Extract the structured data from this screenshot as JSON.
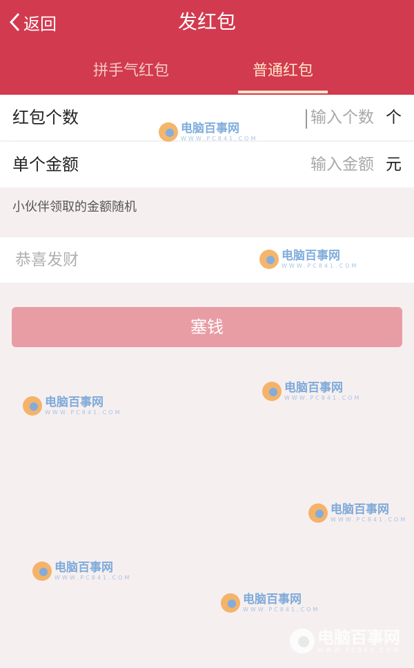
{
  "header": {
    "back_label": "返回",
    "title": "发红包",
    "tabs": [
      {
        "label": "拼手气红包"
      },
      {
        "label": "普通红包"
      }
    ]
  },
  "form": {
    "count": {
      "label": "红包个数",
      "placeholder": "输入个数",
      "unit": "个"
    },
    "amount": {
      "label": "单个金额",
      "placeholder": "输入金额",
      "unit": "元"
    },
    "hint": "小伙伴领取的金额随机",
    "greeting_placeholder": "恭喜发财",
    "submit_label": "塞钱"
  },
  "watermark": {
    "text": "电脑百事网",
    "sub": "WWW.PC841.COM"
  },
  "colors": {
    "header_bg": "#d23a4f",
    "active_tab": "#fde6c8",
    "submit_bg": "#e89da5",
    "page_bg": "#f6eff0"
  }
}
